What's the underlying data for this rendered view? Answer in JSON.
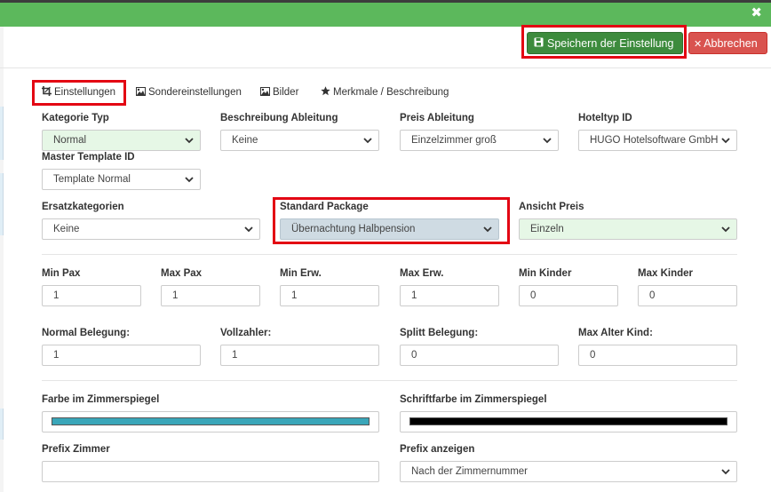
{
  "window": {
    "close_icon": "times-icon"
  },
  "actions": {
    "save_label": "Speichern der Einstellung",
    "save_icon": "floppy-disk-icon",
    "cancel_label": "Abbrechen",
    "cancel_icon": "times-icon"
  },
  "tabs": [
    {
      "label": "Einstellungen",
      "icon": "crop-icon",
      "active": true
    },
    {
      "label": "Sondereinstellungen",
      "icon": "image-icon"
    },
    {
      "label": "Bilder",
      "icon": "image-icon"
    },
    {
      "label": "Merkmale / Beschreibung",
      "icon": "star-icon"
    }
  ],
  "fields": {
    "kategorie_typ": {
      "label": "Kategorie Typ",
      "value": "Normal"
    },
    "beschreibung_ableitung": {
      "label": "Beschreibung Ableitung",
      "value": "Keine"
    },
    "preis_ableitung": {
      "label": "Preis Ableitung",
      "value": "Einzelzimmer groß"
    },
    "hoteltyp_id": {
      "label": "Hoteltyp ID",
      "value": "HUGO Hotelsoftware GmbH"
    },
    "master_template_id": {
      "label": "Master Template ID",
      "value": "Template Normal"
    },
    "ersatzkategorien": {
      "label": "Ersatzkategorien",
      "value": "Keine"
    },
    "standard_package": {
      "label": "Standard Package",
      "value": "Übernachtung Halbpension"
    },
    "ansicht_preis": {
      "label": "Ansicht Preis",
      "value": "Einzeln"
    },
    "min_pax": {
      "label": "Min Pax",
      "value": "1"
    },
    "max_pax": {
      "label": "Max Pax",
      "value": "1"
    },
    "min_erw": {
      "label": "Min Erw.",
      "value": "1"
    },
    "max_erw": {
      "label": "Max Erw.",
      "value": "1"
    },
    "min_kinder": {
      "label": "Min Kinder",
      "value": "0"
    },
    "max_kinder": {
      "label": "Max Kinder",
      "value": "0"
    },
    "normal_belegung": {
      "label": "Normal Belegung:",
      "value": "1"
    },
    "vollzahler": {
      "label": "Vollzahler:",
      "value": "1"
    },
    "splitt_belegung": {
      "label": "Splitt Belegung:",
      "value": "0"
    },
    "max_alter_kind": {
      "label": "Max Alter Kind:",
      "value": "0"
    },
    "farbe_zimmerspiegel": {
      "label": "Farbe im Zimmerspiegel",
      "color": "#3aa6b9"
    },
    "schriftfarbe_zimmerspiegel": {
      "label": "Schriftfarbe im Zimmerspiegel",
      "color": "#000000"
    },
    "prefix_zimmer": {
      "label": "Prefix Zimmer",
      "value": ""
    },
    "prefix_anzeigen": {
      "label": "Prefix anzeigen",
      "value": "Nach der Zimmernummer"
    }
  },
  "colors": {
    "header_green": "#5cb85c",
    "save_green": "#3d8b3d",
    "cancel_red": "#d9534f",
    "highlight_red": "#e30613"
  }
}
